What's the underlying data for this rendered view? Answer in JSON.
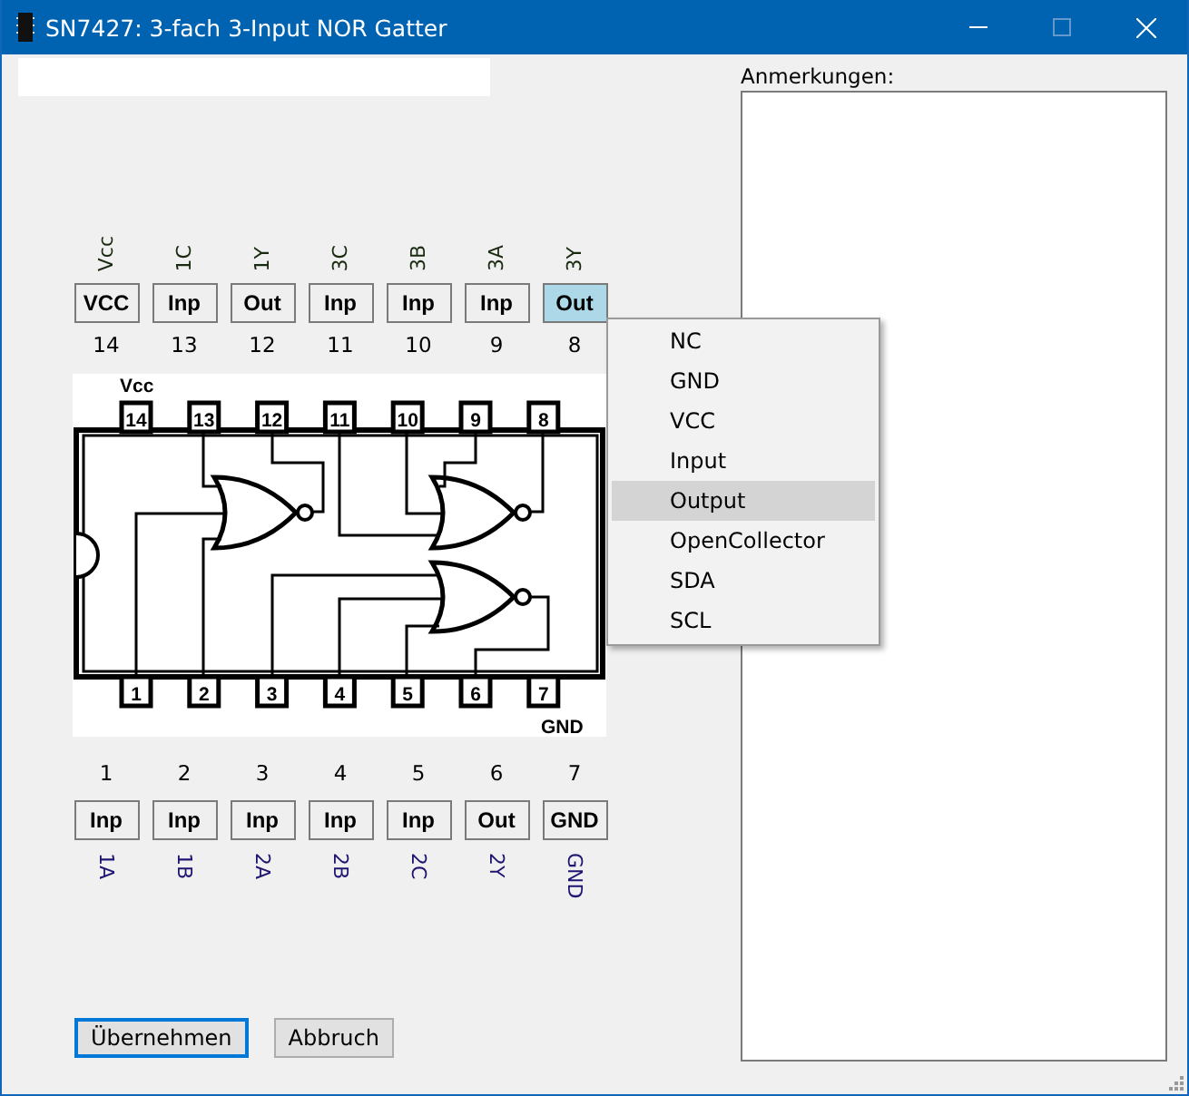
{
  "window": {
    "title": "SN7427: 3-fach 3-Input NOR Gatter"
  },
  "top_pins": [
    {
      "signal": "Vcc",
      "type": "VCC",
      "number": "14",
      "selected": false
    },
    {
      "signal": "1C",
      "type": "Inp",
      "number": "13",
      "selected": false
    },
    {
      "signal": "1Y",
      "type": "Out",
      "number": "12",
      "selected": false
    },
    {
      "signal": "3C",
      "type": "Inp",
      "number": "11",
      "selected": false
    },
    {
      "signal": "3B",
      "type": "Inp",
      "number": "10",
      "selected": false
    },
    {
      "signal": "3A",
      "type": "Inp",
      "number": "9",
      "selected": false
    },
    {
      "signal": "3Y",
      "type": "Out",
      "number": "8",
      "selected": true
    }
  ],
  "chip": {
    "vcc_label": "Vcc",
    "gnd_label": "GND",
    "top_pin_numbers": [
      "14",
      "13",
      "12",
      "11",
      "10",
      "9",
      "8"
    ],
    "bottom_pin_numbers": [
      "1",
      "2",
      "3",
      "4",
      "5",
      "6",
      "7"
    ]
  },
  "bottom_pins": [
    {
      "number": "1",
      "type": "Inp",
      "signal": "1A",
      "selected": false
    },
    {
      "number": "2",
      "type": "Inp",
      "signal": "1B",
      "selected": false
    },
    {
      "number": "3",
      "type": "Inp",
      "signal": "2A",
      "selected": false
    },
    {
      "number": "4",
      "type": "Inp",
      "signal": "2B",
      "selected": false
    },
    {
      "number": "5",
      "type": "Inp",
      "signal": "2C",
      "selected": false
    },
    {
      "number": "6",
      "type": "Out",
      "signal": "2Y",
      "selected": false
    },
    {
      "number": "7",
      "type": "GND",
      "signal": "GND",
      "selected": false
    }
  ],
  "pin_type_menu": [
    {
      "label": "NC",
      "selected": false
    },
    {
      "label": "GND",
      "selected": false
    },
    {
      "label": "VCC",
      "selected": false
    },
    {
      "label": "Input",
      "selected": false
    },
    {
      "label": "Output",
      "selected": true
    },
    {
      "label": "OpenCollector",
      "selected": false
    },
    {
      "label": "SDA",
      "selected": false
    },
    {
      "label": "SCL",
      "selected": false
    }
  ],
  "notes": {
    "label": "Anmerkungen:"
  },
  "buttons": [
    {
      "label": "Übernehmen",
      "default": true
    },
    {
      "label": "Abbruch",
      "default": false
    }
  ]
}
